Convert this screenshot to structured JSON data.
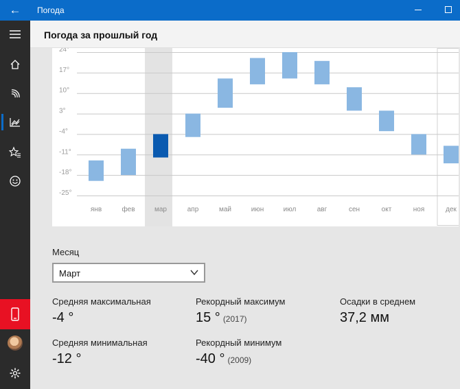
{
  "window": {
    "title": "Погода"
  },
  "page": {
    "title": "Погода за прошлый год"
  },
  "nav": {
    "items": [
      "menu-icon",
      "home-icon",
      "forecast-icon",
      "historical-chart-icon",
      "favorites-icon",
      "feedback-icon"
    ],
    "selected": "historical-chart-icon"
  },
  "month_selector": {
    "label": "Месяц",
    "value": "Март"
  },
  "stats": {
    "avg_max": {
      "label": "Средняя максимальная",
      "value": "-4 °"
    },
    "record_max": {
      "label": "Рекордный максимум",
      "value": "15 °",
      "year": "(2017)"
    },
    "precip": {
      "label": "Осадки в среднем",
      "value": "37,2 мм"
    },
    "avg_min": {
      "label": "Средняя минимальная",
      "value": "-12 °"
    },
    "record_min": {
      "label": "Рекордный минимум",
      "value": "-40 °",
      "year": "(2009)"
    }
  },
  "colors": {
    "accent": "#0b6cc9",
    "bar": "#8ab7e2",
    "bar_selected": "#0a5ab0",
    "phone": "#e81123"
  },
  "chart_data": {
    "type": "bar",
    "categories": [
      "янв",
      "фев",
      "мар",
      "апр",
      "май",
      "июн",
      "июл",
      "авг",
      "сен",
      "окт",
      "ноя",
      "дек"
    ],
    "ticks": [
      "24°",
      "17°",
      "10°",
      "3°",
      "-4°",
      "-11°",
      "-18°",
      "-25°"
    ],
    "tick_values": [
      24,
      17,
      10,
      3,
      -4,
      -11,
      -18,
      -25
    ],
    "low": [
      -20,
      -18,
      -12,
      -5,
      5,
      13,
      15,
      13,
      4,
      -3,
      -11,
      -14
    ],
    "high": [
      -13,
      -9,
      -4,
      3,
      15,
      22,
      24,
      21,
      12,
      4,
      -4,
      -8
    ],
    "selected_index": 2,
    "highlight_index": 11,
    "ylim": [
      -25,
      24
    ],
    "grid": true
  }
}
